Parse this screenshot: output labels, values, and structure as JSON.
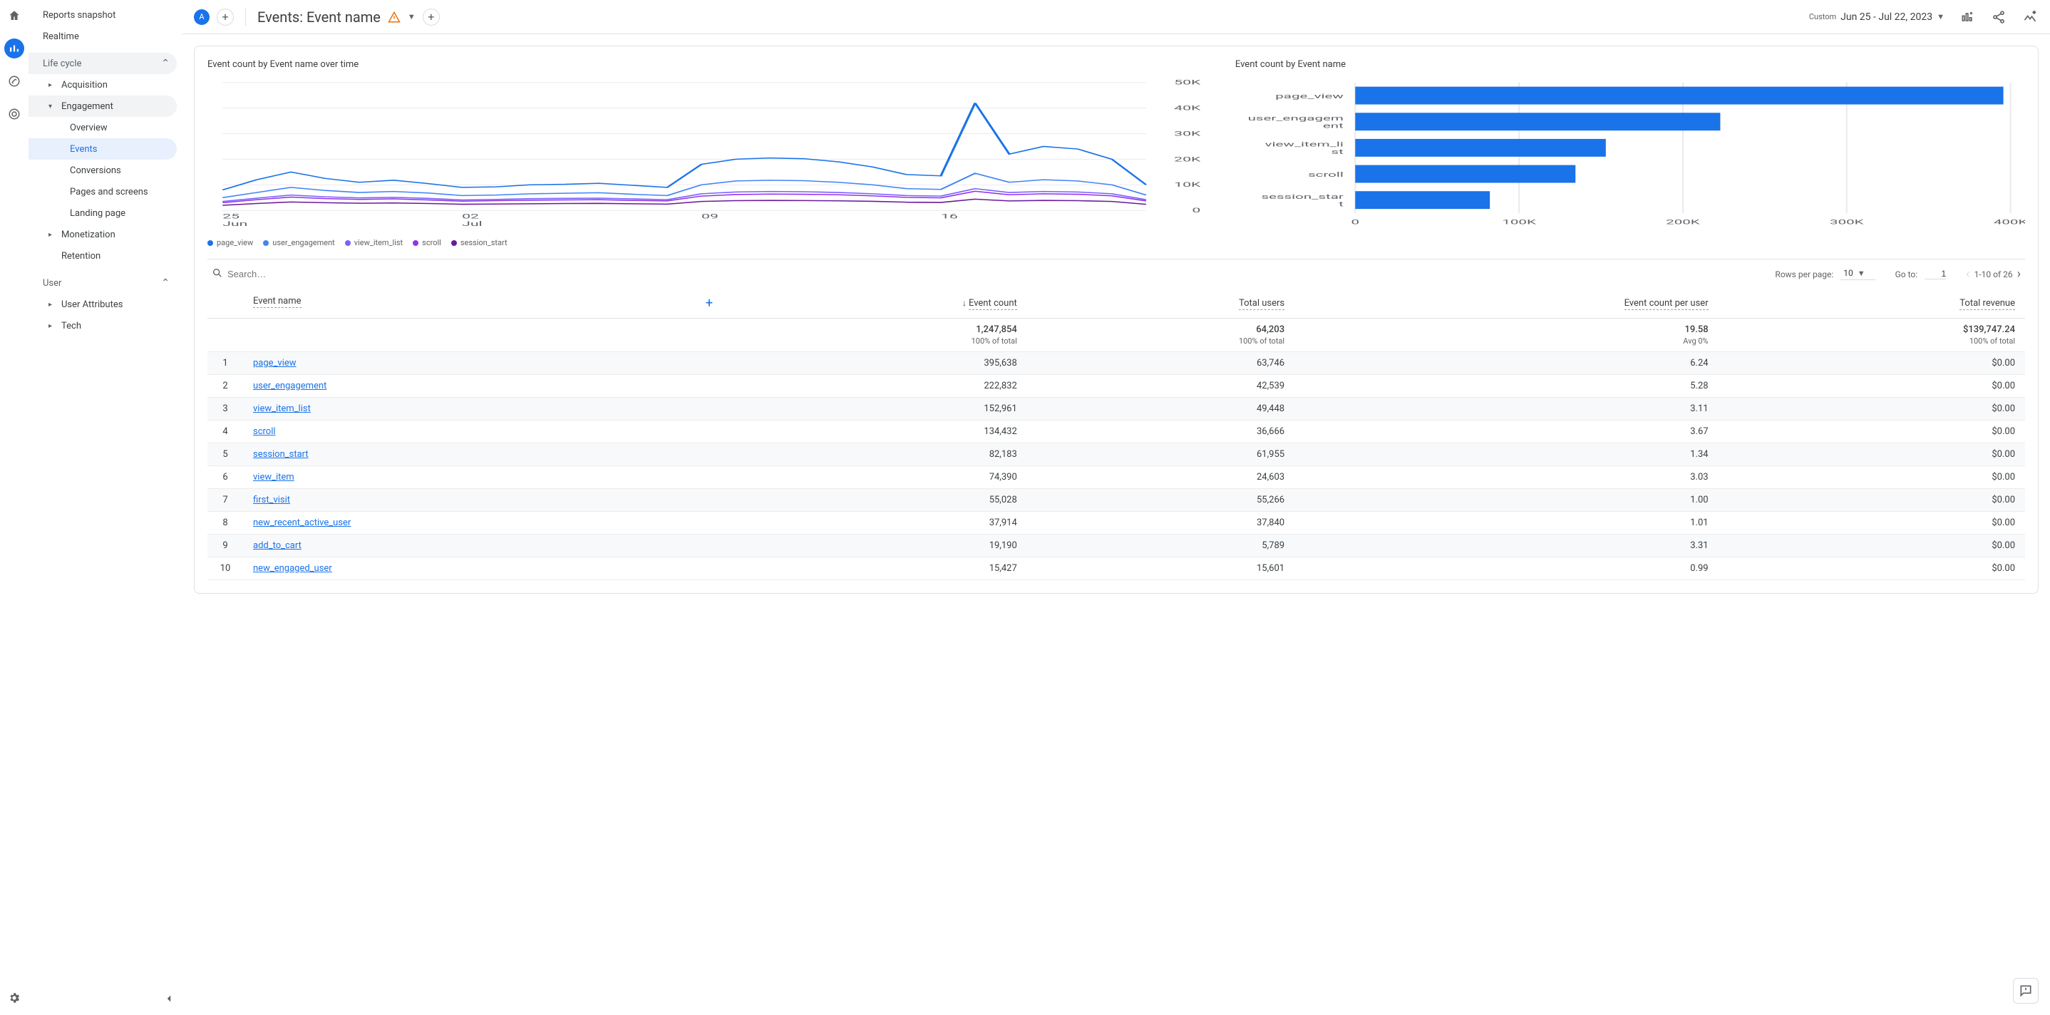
{
  "rail": {
    "items": [
      "home",
      "reports",
      "explore",
      "advertising"
    ]
  },
  "sidebar": {
    "reports_snapshot": "Reports snapshot",
    "realtime": "Realtime",
    "life_cycle": "Life cycle",
    "acquisition": "Acquisition",
    "engagement": "Engagement",
    "overview": "Overview",
    "events": "Events",
    "conversions": "Conversions",
    "pages_screens": "Pages and screens",
    "landing_page": "Landing page",
    "monetization": "Monetization",
    "retention": "Retention",
    "user": "User",
    "user_attributes": "User Attributes",
    "tech": "Tech"
  },
  "header": {
    "segment_chip": "A",
    "title": "Events: Event name",
    "date_label": "Custom",
    "date_range": "Jun 25 - Jul 22, 2023"
  },
  "charts": {
    "line_title": "Event count by Event name over time",
    "bar_title": "Event count by Event name"
  },
  "chart_data": [
    {
      "type": "line",
      "title": "Event count by Event name over time",
      "xlabel": "",
      "ylabel": "",
      "ylim": [
        0,
        50000
      ],
      "yticks": [
        0,
        10000,
        20000,
        30000,
        40000,
        50000
      ],
      "ytick_labels": [
        "0",
        "10K",
        "20K",
        "30K",
        "40K",
        "50K"
      ],
      "x": [
        "Jun 25",
        "Jun 26",
        "Jun 27",
        "Jun 28",
        "Jun 29",
        "Jun 30",
        "Jul 01",
        "Jul 02",
        "Jul 03",
        "Jul 04",
        "Jul 05",
        "Jul 06",
        "Jul 07",
        "Jul 08",
        "Jul 09",
        "Jul 10",
        "Jul 11",
        "Jul 12",
        "Jul 13",
        "Jul 14",
        "Jul 15",
        "Jul 16",
        "Jul 17",
        "Jul 18",
        "Jul 19",
        "Jul 20",
        "Jul 21",
        "Jul 22"
      ],
      "xtick_labels": [
        "25\nJun",
        "02\nJul",
        "09",
        "16"
      ],
      "series": [
        {
          "name": "page_view",
          "color": "#1a73e8",
          "values": [
            8000,
            12000,
            15000,
            12500,
            11000,
            11800,
            10500,
            9000,
            9200,
            10000,
            10200,
            10600,
            9800,
            9000,
            18000,
            20000,
            20500,
            20200,
            19000,
            17000,
            14000,
            13500,
            42000,
            22000,
            25000,
            24000,
            20000,
            10000
          ]
        },
        {
          "name": "user_engagement",
          "color": "#4285f4",
          "values": [
            5000,
            7000,
            9000,
            7800,
            7000,
            7400,
            6800,
            5800,
            6000,
            6500,
            6700,
            6900,
            6300,
            5800,
            10000,
            11500,
            11800,
            11600,
            11000,
            10000,
            8500,
            8200,
            14500,
            11000,
            12000,
            11500,
            10000,
            6000
          ]
        },
        {
          "name": "view_item_list",
          "color": "#7b61ff",
          "values": [
            3500,
            4800,
            6000,
            5300,
            4900,
            5100,
            4700,
            4100,
            4300,
            4600,
            4700,
            4800,
            4500,
            4200,
            6500,
            7200,
            7400,
            7300,
            7000,
            6500,
            5800,
            5600,
            8500,
            7000,
            7400,
            7200,
            6500,
            4200
          ]
        },
        {
          "name": "scroll",
          "color": "#9334e6",
          "values": [
            3000,
            4200,
            5200,
            4600,
            4300,
            4500,
            4100,
            3600,
            3800,
            4000,
            4100,
            4200,
            3900,
            3700,
            5600,
            6200,
            6400,
            6300,
            6100,
            5700,
            5100,
            4900,
            7500,
            6100,
            6500,
            6300,
            5700,
            3700
          ]
        },
        {
          "name": "session_start",
          "color": "#6a1b9a",
          "values": [
            2000,
            2700,
            3300,
            3000,
            2800,
            2900,
            2700,
            2400,
            2500,
            2600,
            2700,
            2750,
            2600,
            2450,
            3500,
            3800,
            3900,
            3850,
            3750,
            3550,
            3200,
            3100,
            4400,
            3700,
            3900,
            3800,
            3500,
            2400
          ]
        }
      ]
    },
    {
      "type": "bar",
      "title": "Event count by Event name",
      "orientation": "horizontal",
      "xlim": [
        0,
        400000
      ],
      "xticks": [
        0,
        100000,
        200000,
        300000,
        400000
      ],
      "xtick_labels": [
        "0",
        "100K",
        "200K",
        "300K",
        "400K"
      ],
      "categories": [
        "page_view",
        "user_engagement",
        "view_item_list",
        "scroll",
        "session_start"
      ],
      "values": [
        395638,
        222832,
        152961,
        134432,
        82183
      ],
      "color": "#1a73e8"
    }
  ],
  "legend": [
    {
      "name": "page_view",
      "color": "#1a73e8"
    },
    {
      "name": "user_engagement",
      "color": "#4285f4"
    },
    {
      "name": "view_item_list",
      "color": "#7b61ff"
    },
    {
      "name": "scroll",
      "color": "#9334e6"
    },
    {
      "name": "session_start",
      "color": "#6a1b9a"
    }
  ],
  "table": {
    "search_placeholder": "Search…",
    "rows_per_page_label": "Rows per page:",
    "rows_per_page_value": "10",
    "goto_label": "Go to:",
    "goto_value": "1",
    "range_text": "1-10 of 26",
    "columns": {
      "event_name": "Event name",
      "event_count": "Event count",
      "total_users": "Total users",
      "epu": "Event count per user",
      "total_revenue": "Total revenue"
    },
    "summary": {
      "event_count": "1,247,854",
      "event_count_sub": "100% of total",
      "total_users": "64,203",
      "total_users_sub": "100% of total",
      "epu": "19.58",
      "epu_sub": "Avg 0%",
      "revenue": "$139,747.24",
      "revenue_sub": "100% of total"
    },
    "rows": [
      {
        "n": "1",
        "name": "page_view",
        "count": "395,638",
        "users": "63,746",
        "epu": "6.24",
        "rev": "$0.00"
      },
      {
        "n": "2",
        "name": "user_engagement",
        "count": "222,832",
        "users": "42,539",
        "epu": "5.28",
        "rev": "$0.00"
      },
      {
        "n": "3",
        "name": "view_item_list",
        "count": "152,961",
        "users": "49,448",
        "epu": "3.11",
        "rev": "$0.00"
      },
      {
        "n": "4",
        "name": "scroll",
        "count": "134,432",
        "users": "36,666",
        "epu": "3.67",
        "rev": "$0.00"
      },
      {
        "n": "5",
        "name": "session_start",
        "count": "82,183",
        "users": "61,955",
        "epu": "1.34",
        "rev": "$0.00"
      },
      {
        "n": "6",
        "name": "view_item",
        "count": "74,390",
        "users": "24,603",
        "epu": "3.03",
        "rev": "$0.00"
      },
      {
        "n": "7",
        "name": "first_visit",
        "count": "55,028",
        "users": "55,266",
        "epu": "1.00",
        "rev": "$0.00"
      },
      {
        "n": "8",
        "name": "new_recent_active_user",
        "count": "37,914",
        "users": "37,840",
        "epu": "1.01",
        "rev": "$0.00"
      },
      {
        "n": "9",
        "name": "add_to_cart",
        "count": "19,190",
        "users": "5,789",
        "epu": "3.31",
        "rev": "$0.00"
      },
      {
        "n": "10",
        "name": "new_engaged_user",
        "count": "15,427",
        "users": "15,601",
        "epu": "0.99",
        "rev": "$0.00"
      }
    ]
  }
}
